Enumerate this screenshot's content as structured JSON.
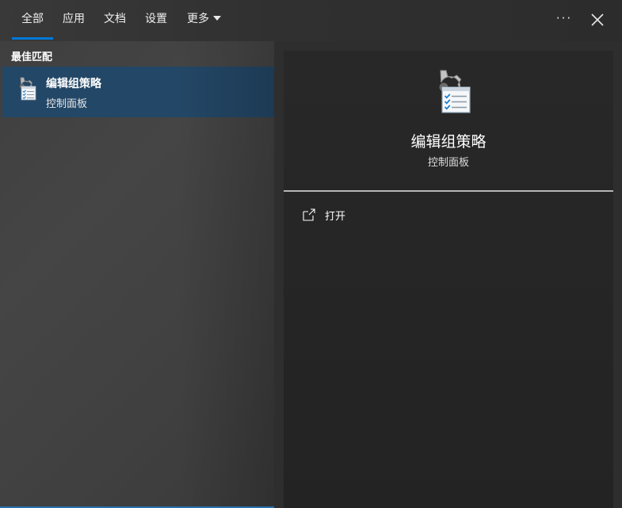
{
  "tabs": [
    {
      "label": "全部",
      "active": true
    },
    {
      "label": "应用"
    },
    {
      "label": "文档"
    },
    {
      "label": "设置"
    },
    {
      "label": "更多"
    }
  ],
  "window_controls": {
    "more_icon": "ellipsis-icon",
    "close_icon": "close-icon"
  },
  "results": {
    "section_title": "最佳匹配",
    "items": [
      {
        "title": "编辑组策略",
        "subtitle": "控制面板",
        "icon": "group-policy-icon",
        "selected": true
      }
    ]
  },
  "detail": {
    "title": "编辑组策略",
    "subtitle": "控制面板",
    "icon": "group-policy-icon",
    "actions": [
      {
        "label": "打开",
        "icon": "open-icon"
      }
    ]
  },
  "colors": {
    "accent": "#0078d7",
    "selected_bg": "#234766"
  }
}
